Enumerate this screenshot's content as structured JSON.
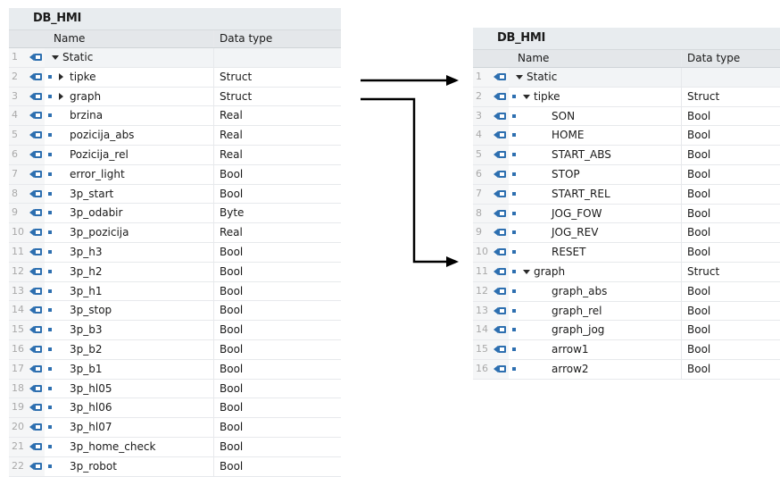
{
  "left_panel": {
    "title": "DB_HMI",
    "columns": {
      "name": "Name",
      "data_type": "Data type"
    },
    "rows": [
      {
        "num": "1",
        "name": "Static",
        "type": "",
        "level": 0,
        "expander": "down",
        "bullet": false
      },
      {
        "num": "2",
        "name": "tipke",
        "type": "Struct",
        "level": 1,
        "expander": "right",
        "bullet": true
      },
      {
        "num": "3",
        "name": "graph",
        "type": "Struct",
        "level": 1,
        "expander": "right",
        "bullet": true
      },
      {
        "num": "4",
        "name": "brzina",
        "type": "Real",
        "level": 1,
        "expander": "",
        "bullet": true
      },
      {
        "num": "5",
        "name": "pozicija_abs",
        "type": "Real",
        "level": 1,
        "expander": "",
        "bullet": true
      },
      {
        "num": "6",
        "name": "Pozicija_rel",
        "type": "Real",
        "level": 1,
        "expander": "",
        "bullet": true
      },
      {
        "num": "7",
        "name": "error_light",
        "type": "Bool",
        "level": 1,
        "expander": "",
        "bullet": true
      },
      {
        "num": "8",
        "name": "3p_start",
        "type": "Bool",
        "level": 1,
        "expander": "",
        "bullet": true
      },
      {
        "num": "9",
        "name": "3p_odabir",
        "type": "Byte",
        "level": 1,
        "expander": "",
        "bullet": true
      },
      {
        "num": "10",
        "name": "3p_pozicija",
        "type": "Real",
        "level": 1,
        "expander": "",
        "bullet": true
      },
      {
        "num": "11",
        "name": "3p_h3",
        "type": "Bool",
        "level": 1,
        "expander": "",
        "bullet": true
      },
      {
        "num": "12",
        "name": "3p_h2",
        "type": "Bool",
        "level": 1,
        "expander": "",
        "bullet": true
      },
      {
        "num": "13",
        "name": "3p_h1",
        "type": "Bool",
        "level": 1,
        "expander": "",
        "bullet": true
      },
      {
        "num": "14",
        "name": "3p_stop",
        "type": "Bool",
        "level": 1,
        "expander": "",
        "bullet": true
      },
      {
        "num": "15",
        "name": "3p_b3",
        "type": "Bool",
        "level": 1,
        "expander": "",
        "bullet": true
      },
      {
        "num": "16",
        "name": "3p_b2",
        "type": "Bool",
        "level": 1,
        "expander": "",
        "bullet": true
      },
      {
        "num": "17",
        "name": "3p_b1",
        "type": "Bool",
        "level": 1,
        "expander": "",
        "bullet": true
      },
      {
        "num": "18",
        "name": "3p_hl05",
        "type": "Bool",
        "level": 1,
        "expander": "",
        "bullet": true
      },
      {
        "num": "19",
        "name": "3p_hl06",
        "type": "Bool",
        "level": 1,
        "expander": "",
        "bullet": true
      },
      {
        "num": "20",
        "name": "3p_hl07",
        "type": "Bool",
        "level": 1,
        "expander": "",
        "bullet": true
      },
      {
        "num": "21",
        "name": "3p_home_check",
        "type": "Bool",
        "level": 1,
        "expander": "",
        "bullet": true
      },
      {
        "num": "22",
        "name": "3p_robot",
        "type": "Bool",
        "level": 1,
        "expander": "",
        "bullet": true
      }
    ]
  },
  "right_panel": {
    "title": "DB_HMI",
    "columns": {
      "name": "Name",
      "data_type": "Data type"
    },
    "rows": [
      {
        "num": "1",
        "name": "Static",
        "type": "",
        "level": 0,
        "expander": "down",
        "bullet": false
      },
      {
        "num": "2",
        "name": "tipke",
        "type": "Struct",
        "level": 1,
        "expander": "down",
        "bullet": true
      },
      {
        "num": "3",
        "name": "SON",
        "type": "Bool",
        "level": 2,
        "expander": "",
        "bullet": true
      },
      {
        "num": "4",
        "name": "HOME",
        "type": "Bool",
        "level": 2,
        "expander": "",
        "bullet": true
      },
      {
        "num": "5",
        "name": "START_ABS",
        "type": "Bool",
        "level": 2,
        "expander": "",
        "bullet": true
      },
      {
        "num": "6",
        "name": "STOP",
        "type": "Bool",
        "level": 2,
        "expander": "",
        "bullet": true
      },
      {
        "num": "7",
        "name": "START_REL",
        "type": "Bool",
        "level": 2,
        "expander": "",
        "bullet": true
      },
      {
        "num": "8",
        "name": "JOG_FOW",
        "type": "Bool",
        "level": 2,
        "expander": "",
        "bullet": true
      },
      {
        "num": "9",
        "name": "JOG_REV",
        "type": "Bool",
        "level": 2,
        "expander": "",
        "bullet": true
      },
      {
        "num": "10",
        "name": "RESET",
        "type": "Bool",
        "level": 2,
        "expander": "",
        "bullet": true
      },
      {
        "num": "11",
        "name": "graph",
        "type": "Struct",
        "level": 1,
        "expander": "down",
        "bullet": true
      },
      {
        "num": "12",
        "name": "graph_abs",
        "type": "Bool",
        "level": 2,
        "expander": "",
        "bullet": true
      },
      {
        "num": "13",
        "name": "graph_rel",
        "type": "Bool",
        "level": 2,
        "expander": "",
        "bullet": true
      },
      {
        "num": "14",
        "name": "graph_jog",
        "type": "Bool",
        "level": 2,
        "expander": "",
        "bullet": true
      },
      {
        "num": "15",
        "name": "arrow1",
        "type": "Bool",
        "level": 2,
        "expander": "",
        "bullet": true
      },
      {
        "num": "16",
        "name": "arrow2",
        "type": "Bool",
        "level": 2,
        "expander": "",
        "bullet": true
      }
    ]
  },
  "colors": {
    "arrow": "#000000",
    "db_icon": "#2d6fb0",
    "header_bg": "#e4e7ea"
  }
}
